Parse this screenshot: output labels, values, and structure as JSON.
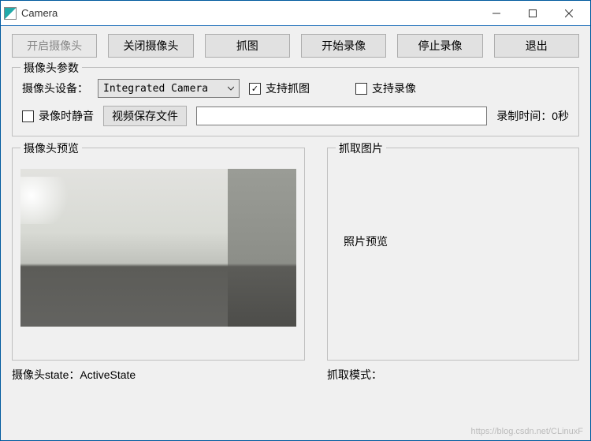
{
  "window": {
    "title": "Camera"
  },
  "toolbar": {
    "open_camera": "开启摄像头",
    "close_camera": "关闭摄像头",
    "capture": "抓图",
    "start_record": "开始录像",
    "stop_record": "停止录像",
    "exit": "退出"
  },
  "params": {
    "group_title": "摄像头参数",
    "device_label": "摄像头设备：",
    "device_selected": "Integrated Camera",
    "support_capture": "支持抓图",
    "support_capture_checked": true,
    "support_record": "支持录像",
    "support_record_checked": false,
    "mute_on_record": "录像时静音",
    "mute_checked": false,
    "video_save_btn": "视频保存文件",
    "video_save_path": "",
    "record_time_label": "录制时间：0秒"
  },
  "preview": {
    "left_title": "摄像头预览",
    "right_title": "抓取图片",
    "photo_placeholder": "照片预览"
  },
  "status": {
    "camera_state": "摄像头state：ActiveState",
    "capture_mode": "抓取模式："
  },
  "watermark": "https://blog.csdn.net/CLinuxF"
}
